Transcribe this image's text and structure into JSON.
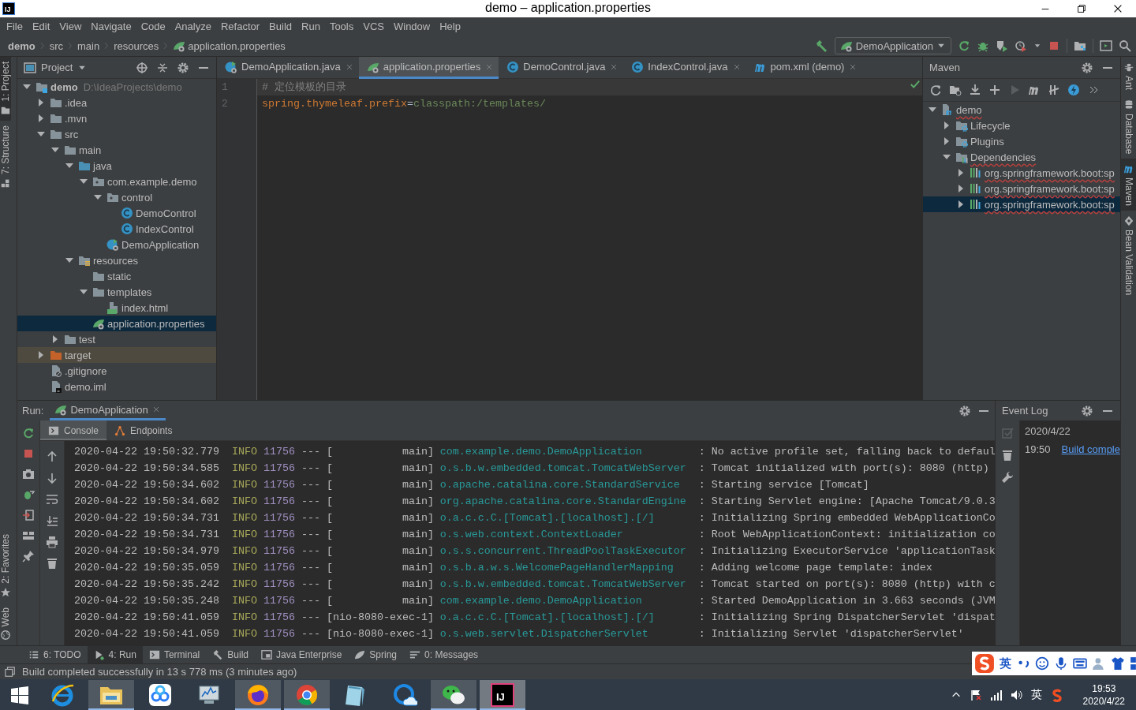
{
  "window": {
    "app_icon": "IJ",
    "title": "demo – application.properties"
  },
  "menu": [
    "File",
    "Edit",
    "View",
    "Navigate",
    "Code",
    "Analyze",
    "Refactor",
    "Build",
    "Run",
    "Tools",
    "VCS",
    "Window",
    "Help"
  ],
  "breadcrumbs": [
    {
      "label": "demo",
      "kind": "project"
    },
    {
      "label": "src",
      "kind": "plain"
    },
    {
      "label": "main",
      "kind": "plain"
    },
    {
      "label": "resources",
      "kind": "plain"
    },
    {
      "label": "application.properties",
      "kind": "properties"
    }
  ],
  "run_config": "DemoApplication",
  "left_tool_tabs": [
    {
      "label": "1: Project",
      "kind": "folder",
      "selected": true
    },
    {
      "label": "7: Structure",
      "kind": "structure",
      "selected": false
    }
  ],
  "left_tool_tabs_bottom": [
    {
      "label": "2: Favorites",
      "kind": "star",
      "selected": false
    },
    {
      "label": "Web",
      "kind": "globe",
      "selected": false
    }
  ],
  "project_panel": {
    "title": "Project",
    "tree": [
      {
        "label": "demo",
        "path": "D:\\IdeaProjects\\demo",
        "kind": "module",
        "expanded": true,
        "selected": false,
        "excluded": false,
        "children": [
          {
            "label": ".idea",
            "kind": "folder",
            "expanded": false,
            "selected": false,
            "excluded": false
          },
          {
            "label": ".mvn",
            "kind": "folder",
            "expanded": false,
            "selected": false,
            "excluded": false
          },
          {
            "label": "src",
            "kind": "folder",
            "expanded": true,
            "selected": false,
            "excluded": false,
            "children": [
              {
                "label": "main",
                "kind": "folder",
                "expanded": true,
                "selected": false,
                "excluded": false,
                "children": [
                  {
                    "label": "java",
                    "kind": "source",
                    "expanded": true,
                    "selected": false,
                    "excluded": false,
                    "children": [
                      {
                        "label": "com.example.demo",
                        "kind": "package",
                        "expanded": true,
                        "selected": false,
                        "excluded": false,
                        "children": [
                          {
                            "label": "control",
                            "kind": "package",
                            "expanded": true,
                            "selected": false,
                            "excluded": false,
                            "children": [
                              {
                                "label": "DemoControl",
                                "kind": "class",
                                "selected": false,
                                "excluded": false
                              },
                              {
                                "label": "IndexControl",
                                "kind": "class",
                                "selected": false,
                                "excluded": false
                              }
                            ]
                          },
                          {
                            "label": "DemoApplication",
                            "kind": "springclass",
                            "selected": false,
                            "excluded": false
                          }
                        ]
                      }
                    ]
                  },
                  {
                    "label": "resources",
                    "kind": "resources",
                    "expanded": true,
                    "selected": false,
                    "excluded": false,
                    "children": [
                      {
                        "label": "static",
                        "kind": "folder",
                        "selected": false,
                        "excluded": false
                      },
                      {
                        "label": "templates",
                        "kind": "folder",
                        "expanded": true,
                        "selected": false,
                        "excluded": false,
                        "children": [
                          {
                            "label": "index.html",
                            "kind": "html",
                            "selected": false,
                            "excluded": false
                          }
                        ]
                      },
                      {
                        "label": "application.properties",
                        "kind": "properties",
                        "selected": true,
                        "excluded": false
                      }
                    ]
                  }
                ]
              },
              {
                "label": "test",
                "kind": "folder",
                "expanded": false,
                "selected": false,
                "excluded": false
              }
            ]
          },
          {
            "label": "target",
            "kind": "excludedfolder",
            "expanded": false,
            "selected": false,
            "excluded": true
          },
          {
            "label": ".gitignore",
            "kind": "ignore",
            "selected": false,
            "excluded": false
          },
          {
            "label": "demo.iml",
            "kind": "iml",
            "selected": false,
            "excluded": false
          }
        ]
      }
    ]
  },
  "editor": {
    "tabs": [
      {
        "label": "DemoApplication.java",
        "kind": "springclass",
        "selected": false
      },
      {
        "label": "application.properties",
        "kind": "properties",
        "selected": true
      },
      {
        "label": "DemoControl.java",
        "kind": "class",
        "selected": false
      },
      {
        "label": "IndexControl.java",
        "kind": "class",
        "selected": false
      },
      {
        "label": "pom.xml (demo)",
        "kind": "maven",
        "selected": false
      }
    ],
    "lines": [
      {
        "number": "1",
        "current": true,
        "segments": [
          {
            "text": "# 定位模板的目录",
            "kind": "comment"
          }
        ]
      },
      {
        "number": "2",
        "current": false,
        "segments": [
          {
            "text": "spring.thymeleaf.prefix",
            "kind": "key"
          },
          {
            "text": "=",
            "kind": "punct"
          },
          {
            "text": "classpath:/templates/",
            "kind": "value"
          }
        ]
      }
    ]
  },
  "maven_panel": {
    "title": "Maven",
    "tree": [
      {
        "label": "demo",
        "kind": "mavenmodule",
        "expanded": true,
        "selected": false,
        "spell_error": true,
        "children": [
          {
            "label": "Lifecycle",
            "kind": "gearfolder",
            "expanded": false,
            "selected": false,
            "spell_error": false
          },
          {
            "label": "Plugins",
            "kind": "gearfolder",
            "expanded": false,
            "selected": false,
            "spell_error": false
          },
          {
            "label": "Dependencies",
            "kind": "depfolder",
            "expanded": true,
            "selected": false,
            "spell_error": true,
            "children": [
              {
                "label": "org.springframework.boot:sp",
                "kind": "library",
                "expanded": false,
                "selected": false,
                "spell_error": true
              },
              {
                "label": "org.springframework.boot:sp",
                "kind": "library",
                "expanded": false,
                "selected": false,
                "spell_error": true
              },
              {
                "label": "org.springframework.boot:sp",
                "kind": "library",
                "expanded": false,
                "selected": true,
                "spell_error": true
              }
            ]
          }
        ]
      }
    ]
  },
  "right_tool_tabs": [
    {
      "label": "Ant",
      "kind": "ant",
      "selected": false
    },
    {
      "label": "Database",
      "kind": "database",
      "selected": false
    },
    {
      "label": "Maven",
      "kind": "maven",
      "selected": true
    },
    {
      "label": "Bean Validation",
      "kind": "bean",
      "selected": false
    }
  ],
  "run_panel": {
    "label": "Run:",
    "tab": "DemoApplication",
    "subtabs": [
      {
        "label": "Console",
        "kind": "console",
        "selected": true
      },
      {
        "label": "Endpoints",
        "kind": "endpoints",
        "selected": false
      }
    ],
    "log": [
      {
        "time": "2020-04-22 19:50:32.779",
        "level": "INFO",
        "pid": "11756",
        "sep": "---",
        "thread": "[           main]",
        "logger": "com.example.demo.DemoApplication",
        "message": ": No active profile set, falling back to defaul"
      },
      {
        "time": "2020-04-22 19:50:34.585",
        "level": "INFO",
        "pid": "11756",
        "sep": "---",
        "thread": "[           main]",
        "logger": "o.s.b.w.embedded.tomcat.TomcatWebServer",
        "message": ": Tomcat initialized with port(s): 8080 (http)"
      },
      {
        "time": "2020-04-22 19:50:34.602",
        "level": "INFO",
        "pid": "11756",
        "sep": "---",
        "thread": "[           main]",
        "logger": "o.apache.catalina.core.StandardService",
        "message": ": Starting service [Tomcat]"
      },
      {
        "time": "2020-04-22 19:50:34.602",
        "level": "INFO",
        "pid": "11756",
        "sep": "---",
        "thread": "[           main]",
        "logger": "org.apache.catalina.core.StandardEngine",
        "message": ": Starting Servlet engine: [Apache Tomcat/9.0.3"
      },
      {
        "time": "2020-04-22 19:50:34.731",
        "level": "INFO",
        "pid": "11756",
        "sep": "---",
        "thread": "[           main]",
        "logger": "o.a.c.c.C.[Tomcat].[localhost].[/]",
        "message": ": Initializing Spring embedded WebApplicationCo"
      },
      {
        "time": "2020-04-22 19:50:34.731",
        "level": "INFO",
        "pid": "11756",
        "sep": "---",
        "thread": "[           main]",
        "logger": "o.s.web.context.ContextLoader",
        "message": ": Root WebApplicationContext: initialization co"
      },
      {
        "time": "2020-04-22 19:50:34.979",
        "level": "INFO",
        "pid": "11756",
        "sep": "---",
        "thread": "[           main]",
        "logger": "o.s.s.concurrent.ThreadPoolTaskExecutor",
        "message": ": Initializing ExecutorService 'applicationTask"
      },
      {
        "time": "2020-04-22 19:50:35.059",
        "level": "INFO",
        "pid": "11756",
        "sep": "---",
        "thread": "[           main]",
        "logger": "o.s.b.a.w.s.WelcomePageHandlerMapping",
        "message": ": Adding welcome page template: index"
      },
      {
        "time": "2020-04-22 19:50:35.242",
        "level": "INFO",
        "pid": "11756",
        "sep": "---",
        "thread": "[           main]",
        "logger": "o.s.b.w.embedded.tomcat.TomcatWebServer",
        "message": ": Tomcat started on port(s): 8080 (http) with c"
      },
      {
        "time": "2020-04-22 19:50:35.248",
        "level": "INFO",
        "pid": "11756",
        "sep": "---",
        "thread": "[           main]",
        "logger": "com.example.demo.DemoApplication",
        "message": ": Started DemoApplication in 3.663 seconds (JVM"
      },
      {
        "time": "2020-04-22 19:50:41.059",
        "level": "INFO",
        "pid": "11756",
        "sep": "---",
        "thread": "[nio-8080-exec-1]",
        "logger": "o.a.c.c.C.[Tomcat].[localhost].[/]",
        "message": ": Initializing Spring DispatcherServlet 'dispat"
      },
      {
        "time": "2020-04-22 19:50:41.059",
        "level": "INFO",
        "pid": "11756",
        "sep": "---",
        "thread": "[nio-8080-exec-1]",
        "logger": "o.s.web.servlet.DispatcherServlet",
        "message": ": Initializing Servlet 'dispatcherServlet'"
      }
    ]
  },
  "event_log": {
    "title": "Event Log",
    "date": "2020/4/22",
    "time": "19:50",
    "link": "Build comple"
  },
  "bottom_tabs": [
    {
      "label": "6: TODO",
      "kind": "todo",
      "selected": false
    },
    {
      "label": "4: Run",
      "kind": "run",
      "selected": true
    },
    {
      "label": "Terminal",
      "kind": "terminal",
      "selected": false
    },
    {
      "label": "Build",
      "kind": "build",
      "selected": false
    },
    {
      "label": "Java Enterprise",
      "kind": "javaee",
      "selected": false
    },
    {
      "label": "Spring",
      "kind": "spring",
      "selected": false
    },
    {
      "label": "0: Messages",
      "kind": "messages",
      "selected": false
    }
  ],
  "status": "Build completed successfully in 13 s 778 ms (3 minutes ago)",
  "ime_bar": {
    "mode": "英"
  },
  "taskbar": {
    "apps": [
      {
        "kind": "ie",
        "running": false,
        "selected": false
      },
      {
        "kind": "explorer",
        "running": true,
        "selected": false
      },
      {
        "kind": "netdisk",
        "running": false,
        "selected": false
      },
      {
        "kind": "monitor",
        "running": false,
        "selected": false
      },
      {
        "kind": "firefox",
        "running": true,
        "selected": false
      },
      {
        "kind": "chrome",
        "running": true,
        "selected": false
      },
      {
        "kind": "notepad",
        "running": false,
        "selected": false
      },
      {
        "kind": "cloudbrowser",
        "running": false,
        "selected": false
      },
      {
        "kind": "wechat",
        "running": true,
        "selected": false
      },
      {
        "kind": "intellij",
        "label": "IJ",
        "running": true,
        "selected": true
      }
    ],
    "tray_lang": "英",
    "time": "19:53",
    "date": "2020/4/22"
  }
}
